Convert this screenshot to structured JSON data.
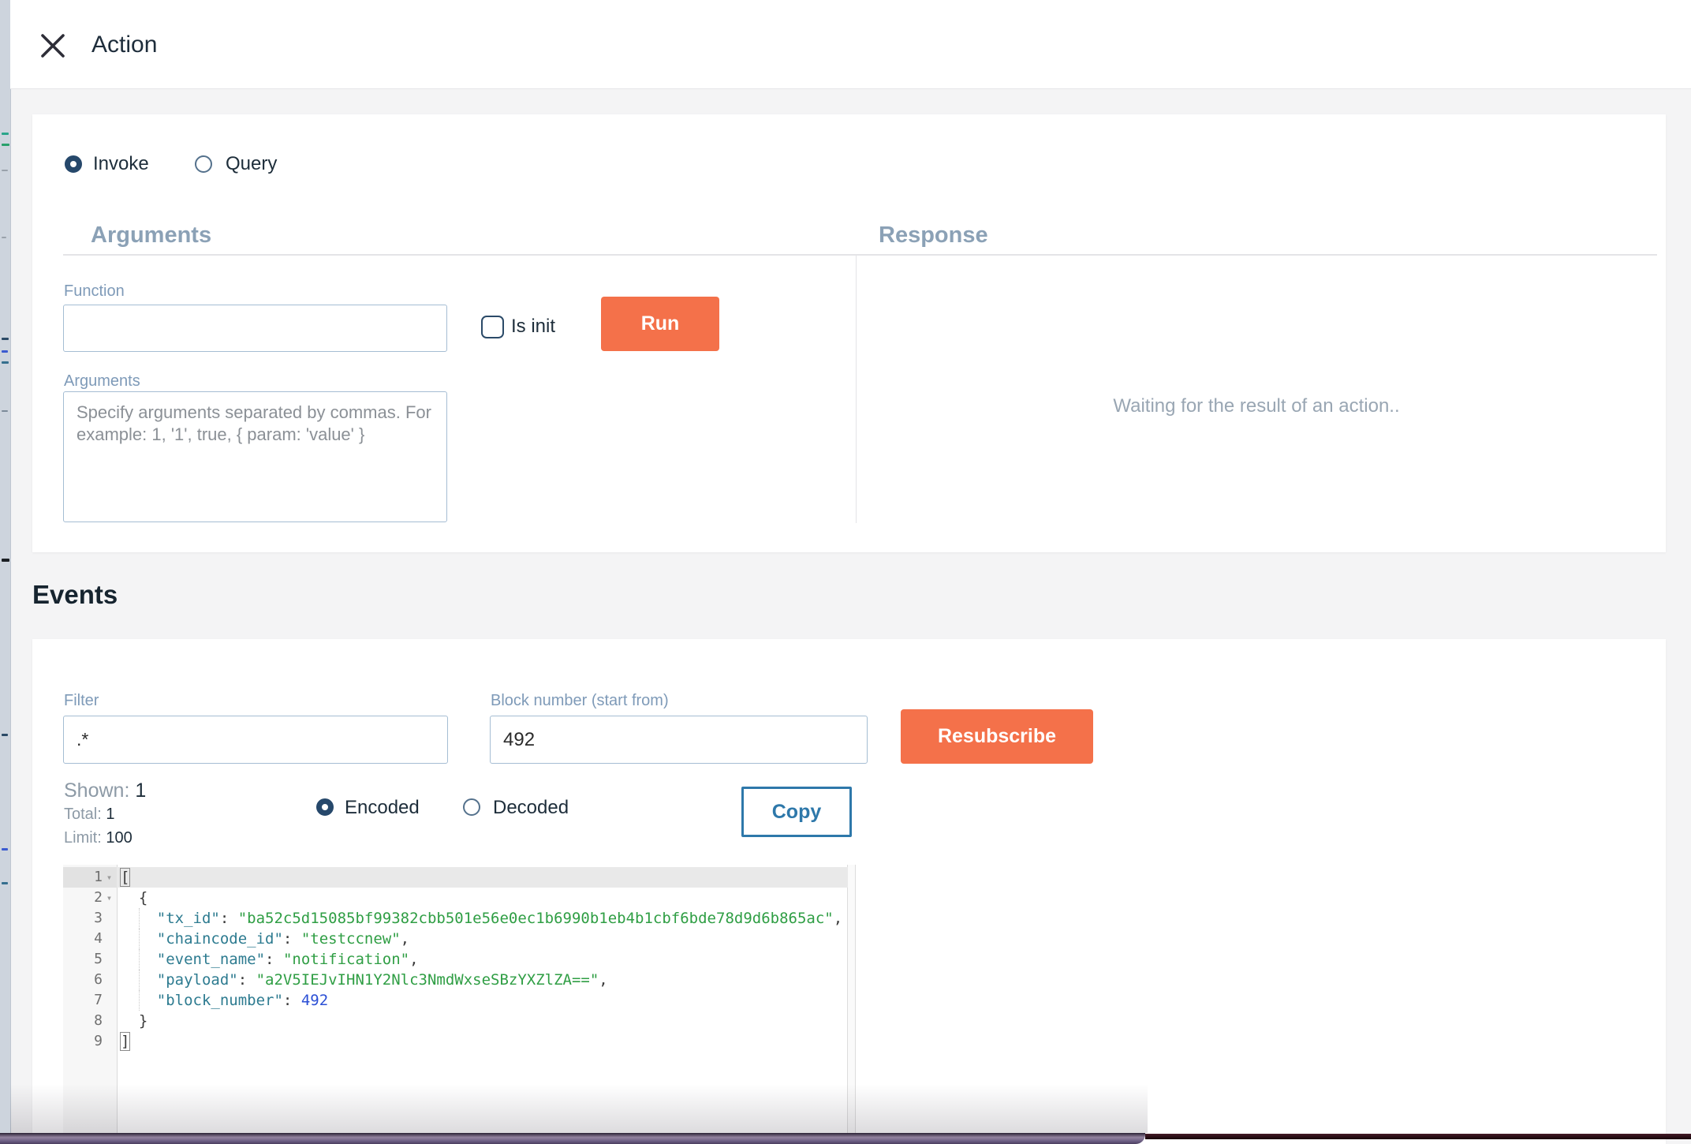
{
  "header": {
    "title": "Action"
  },
  "action_type": {
    "options": [
      {
        "label": "Invoke",
        "selected": true
      },
      {
        "label": "Query",
        "selected": false
      }
    ]
  },
  "arguments_panel": {
    "title": "Arguments",
    "function_label": "Function",
    "function_value": "",
    "is_init_label": "Is init",
    "run_button": "Run",
    "arguments_label": "Arguments",
    "arguments_placeholder": "Specify arguments separated by commas. For example: 1, '1', true, { param: 'value' }"
  },
  "response_panel": {
    "title": "Response",
    "waiting_text": "Waiting for the result of an action.."
  },
  "events": {
    "title": "Events",
    "filter_label": "Filter",
    "filter_value": ".*",
    "block_number_label": "Block number (start from)",
    "block_number_value": "492",
    "resubscribe_button": "Resubscribe",
    "stats": {
      "shown_label": "Shown:",
      "shown_value": "1",
      "total_label": "Total:",
      "total_value": "1",
      "limit_label": "Limit:",
      "limit_value": "100"
    },
    "encoding_options": [
      {
        "label": "Encoded",
        "selected": true
      },
      {
        "label": "Decoded",
        "selected": false
      }
    ],
    "copy_button": "Copy"
  },
  "colors": {
    "accent_orange": "#f4714a",
    "copy_blue": "#2e78aa",
    "section_header_blue": "#8ba1b6",
    "radio_navy": "#26486b",
    "code_key": "#2d7b90",
    "code_string": "#2f9e44",
    "code_number": "#2b4fd5"
  },
  "editor": {
    "lines": [
      {
        "num": 1,
        "fold": true,
        "active": true,
        "tokens": [
          {
            "c": "p",
            "v": "[",
            "match": true
          }
        ]
      },
      {
        "num": 2,
        "fold": true,
        "tokens": [
          {
            "c": "p",
            "v": "  {"
          }
        ]
      },
      {
        "num": 3,
        "guide": true,
        "tokens": [
          {
            "c": "p",
            "v": "    "
          },
          {
            "c": "k",
            "v": "\"tx_id\""
          },
          {
            "c": "p",
            "v": ": "
          },
          {
            "c": "s",
            "v": "\"ba52c5d15085bf99382cbb501e56e0ec1b6990b1eb4b1cbf6bde78d9d6b865ac\""
          },
          {
            "c": "p",
            "v": ","
          }
        ]
      },
      {
        "num": 4,
        "guide": true,
        "tokens": [
          {
            "c": "p",
            "v": "    "
          },
          {
            "c": "k",
            "v": "\"chaincode_id\""
          },
          {
            "c": "p",
            "v": ": "
          },
          {
            "c": "s",
            "v": "\"testccnew\""
          },
          {
            "c": "p",
            "v": ","
          }
        ]
      },
      {
        "num": 5,
        "guide": true,
        "tokens": [
          {
            "c": "p",
            "v": "    "
          },
          {
            "c": "k",
            "v": "\"event_name\""
          },
          {
            "c": "p",
            "v": ": "
          },
          {
            "c": "s",
            "v": "\"notification\""
          },
          {
            "c": "p",
            "v": ","
          }
        ]
      },
      {
        "num": 6,
        "guide": true,
        "tokens": [
          {
            "c": "p",
            "v": "    "
          },
          {
            "c": "k",
            "v": "\"payload\""
          },
          {
            "c": "p",
            "v": ": "
          },
          {
            "c": "s",
            "v": "\"a2V5IEJvIHN1Y2Nlc3NmdWxseSBzYXZlZA==\""
          },
          {
            "c": "p",
            "v": ","
          }
        ]
      },
      {
        "num": 7,
        "guide": true,
        "tokens": [
          {
            "c": "p",
            "v": "    "
          },
          {
            "c": "k",
            "v": "\"block_number\""
          },
          {
            "c": "p",
            "v": ": "
          },
          {
            "c": "n",
            "v": "492"
          }
        ]
      },
      {
        "num": 8,
        "tokens": [
          {
            "c": "p",
            "v": "  }"
          }
        ]
      },
      {
        "num": 9,
        "tokens": [
          {
            "c": "p",
            "v": "]",
            "match": true
          }
        ]
      }
    ]
  }
}
